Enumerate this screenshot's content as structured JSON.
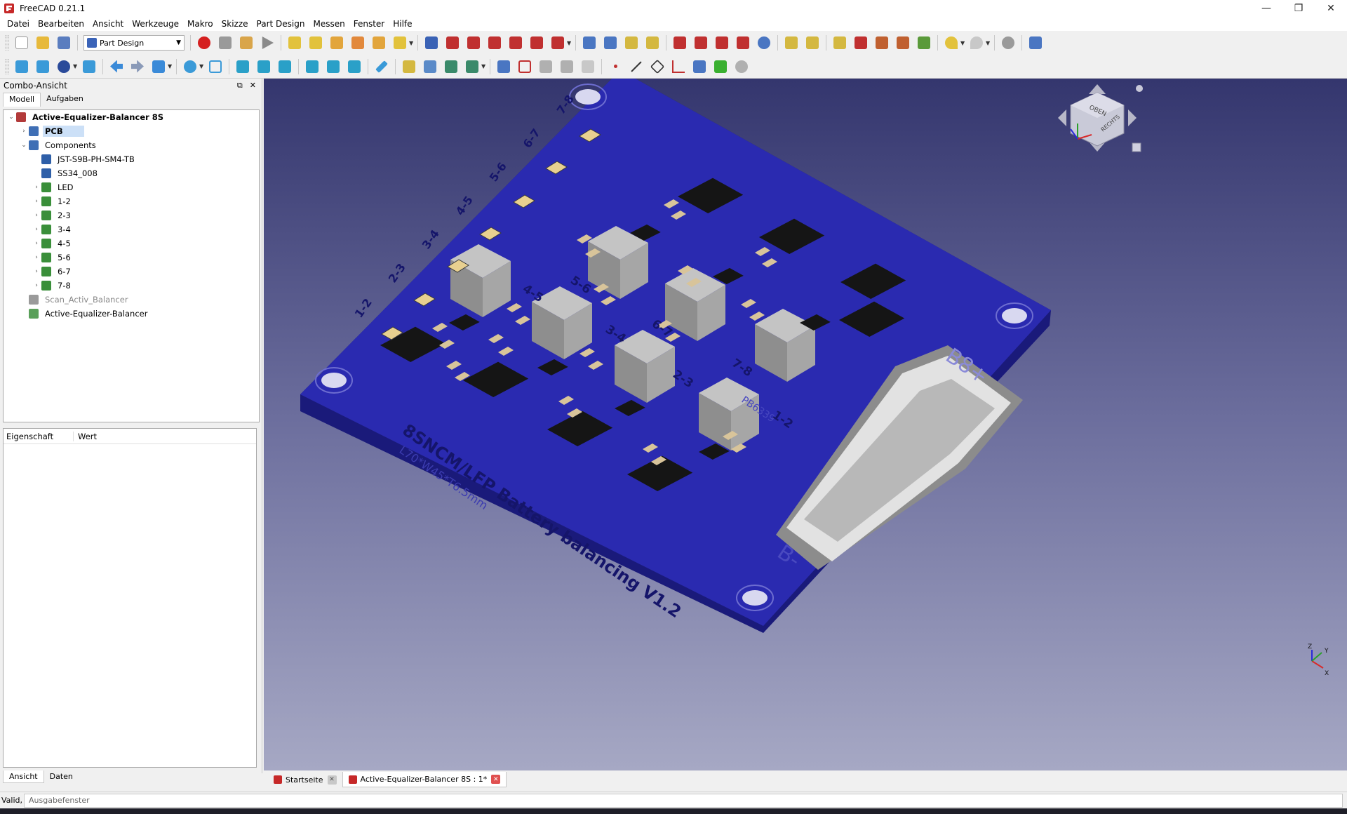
{
  "window": {
    "title": "FreeCAD 0.21.1",
    "controls": {
      "minimize": "—",
      "restore": "❐",
      "close": "✕"
    }
  },
  "menu": [
    "Datei",
    "Bearbeiten",
    "Ansicht",
    "Werkzeuge",
    "Makro",
    "Skizze",
    "Part Design",
    "Messen",
    "Fenster",
    "Hilfe"
  ],
  "workbench": {
    "selected": "Part Design"
  },
  "combo": {
    "title": "Combo-Ansicht",
    "tabs": [
      "Modell",
      "Aufgaben"
    ],
    "tree": [
      {
        "label": "Active-Equalizer-Balancer 8S",
        "depth": 0,
        "expander": "open",
        "bold": true,
        "icon": "document-icon",
        "color": "#b23a3a"
      },
      {
        "label": "PCB",
        "depth": 1,
        "expander": "closed",
        "bold": true,
        "selected": true,
        "icon": "part-icon",
        "color": "#3f6fb5"
      },
      {
        "label": "Components",
        "depth": 1,
        "expander": "open",
        "icon": "group-icon",
        "color": "#3f6fb5"
      },
      {
        "label": "JST-S9B-PH-SM4-TB",
        "depth": 2,
        "expander": "",
        "icon": "solid-icon",
        "color": "#2e5fa8"
      },
      {
        "label": "SS34_008",
        "depth": 2,
        "expander": "",
        "icon": "solid-icon",
        "color": "#2e5fa8"
      },
      {
        "label": "LED",
        "depth": 2,
        "expander": "closed",
        "icon": "group-icon",
        "color": "#3a8f3a"
      },
      {
        "label": "1-2",
        "depth": 2,
        "expander": "closed",
        "icon": "group-icon",
        "color": "#3a8f3a"
      },
      {
        "label": "2-3",
        "depth": 2,
        "expander": "closed",
        "icon": "group-icon",
        "color": "#3a8f3a"
      },
      {
        "label": "3-4",
        "depth": 2,
        "expander": "closed",
        "icon": "group-icon",
        "color": "#3a8f3a"
      },
      {
        "label": "4-5",
        "depth": 2,
        "expander": "closed",
        "icon": "group-icon",
        "color": "#3a8f3a"
      },
      {
        "label": "5-6",
        "depth": 2,
        "expander": "closed",
        "icon": "group-icon",
        "color": "#3a8f3a"
      },
      {
        "label": "6-7",
        "depth": 2,
        "expander": "closed",
        "icon": "group-icon",
        "color": "#3a8f3a"
      },
      {
        "label": "7-8",
        "depth": 2,
        "expander": "closed",
        "icon": "group-icon",
        "color": "#3a8f3a"
      },
      {
        "label": "Scan_Activ_Balancer",
        "depth": 1,
        "expander": "",
        "greyed": true,
        "icon": "mesh-icon",
        "color": "#9a9a9a"
      },
      {
        "label": "Active-Equalizer-Balancer",
        "depth": 1,
        "expander": "",
        "icon": "mesh-icon",
        "color": "#5aa05a"
      }
    ],
    "property_headers": [
      "Eigenschaft",
      "Wert"
    ],
    "bottom_tabs": [
      "Ansicht",
      "Daten"
    ]
  },
  "viewport": {
    "board_color": "#2a2ab0",
    "silkscreen": {
      "title": "8SNCM/LFP Battery balancing V1.2",
      "dimensions": "L70*W45*T6.5mm",
      "part_code": "PB6339",
      "positive": "B8+",
      "negative": "B-",
      "cell_labels": [
        "1-2",
        "2-3",
        "3-4",
        "4-5",
        "5-6",
        "6-7",
        "7-8"
      ],
      "led_labels": [
        "1-2",
        "2-3",
        "3-4",
        "4-5",
        "5-6",
        "6-7",
        "7-8"
      ]
    },
    "navcube": {
      "top": "OBEN",
      "right": "RECHTS"
    },
    "axes": [
      "Z",
      "X",
      "Y"
    ]
  },
  "doc_tabs": [
    {
      "label": "Startseite",
      "active": false
    },
    {
      "label": "Active-Equalizer-Balancer 8S : 1*",
      "active": true
    }
  ],
  "status": {
    "left": "Valid,",
    "report_placeholder": "Ausgabefenster"
  }
}
